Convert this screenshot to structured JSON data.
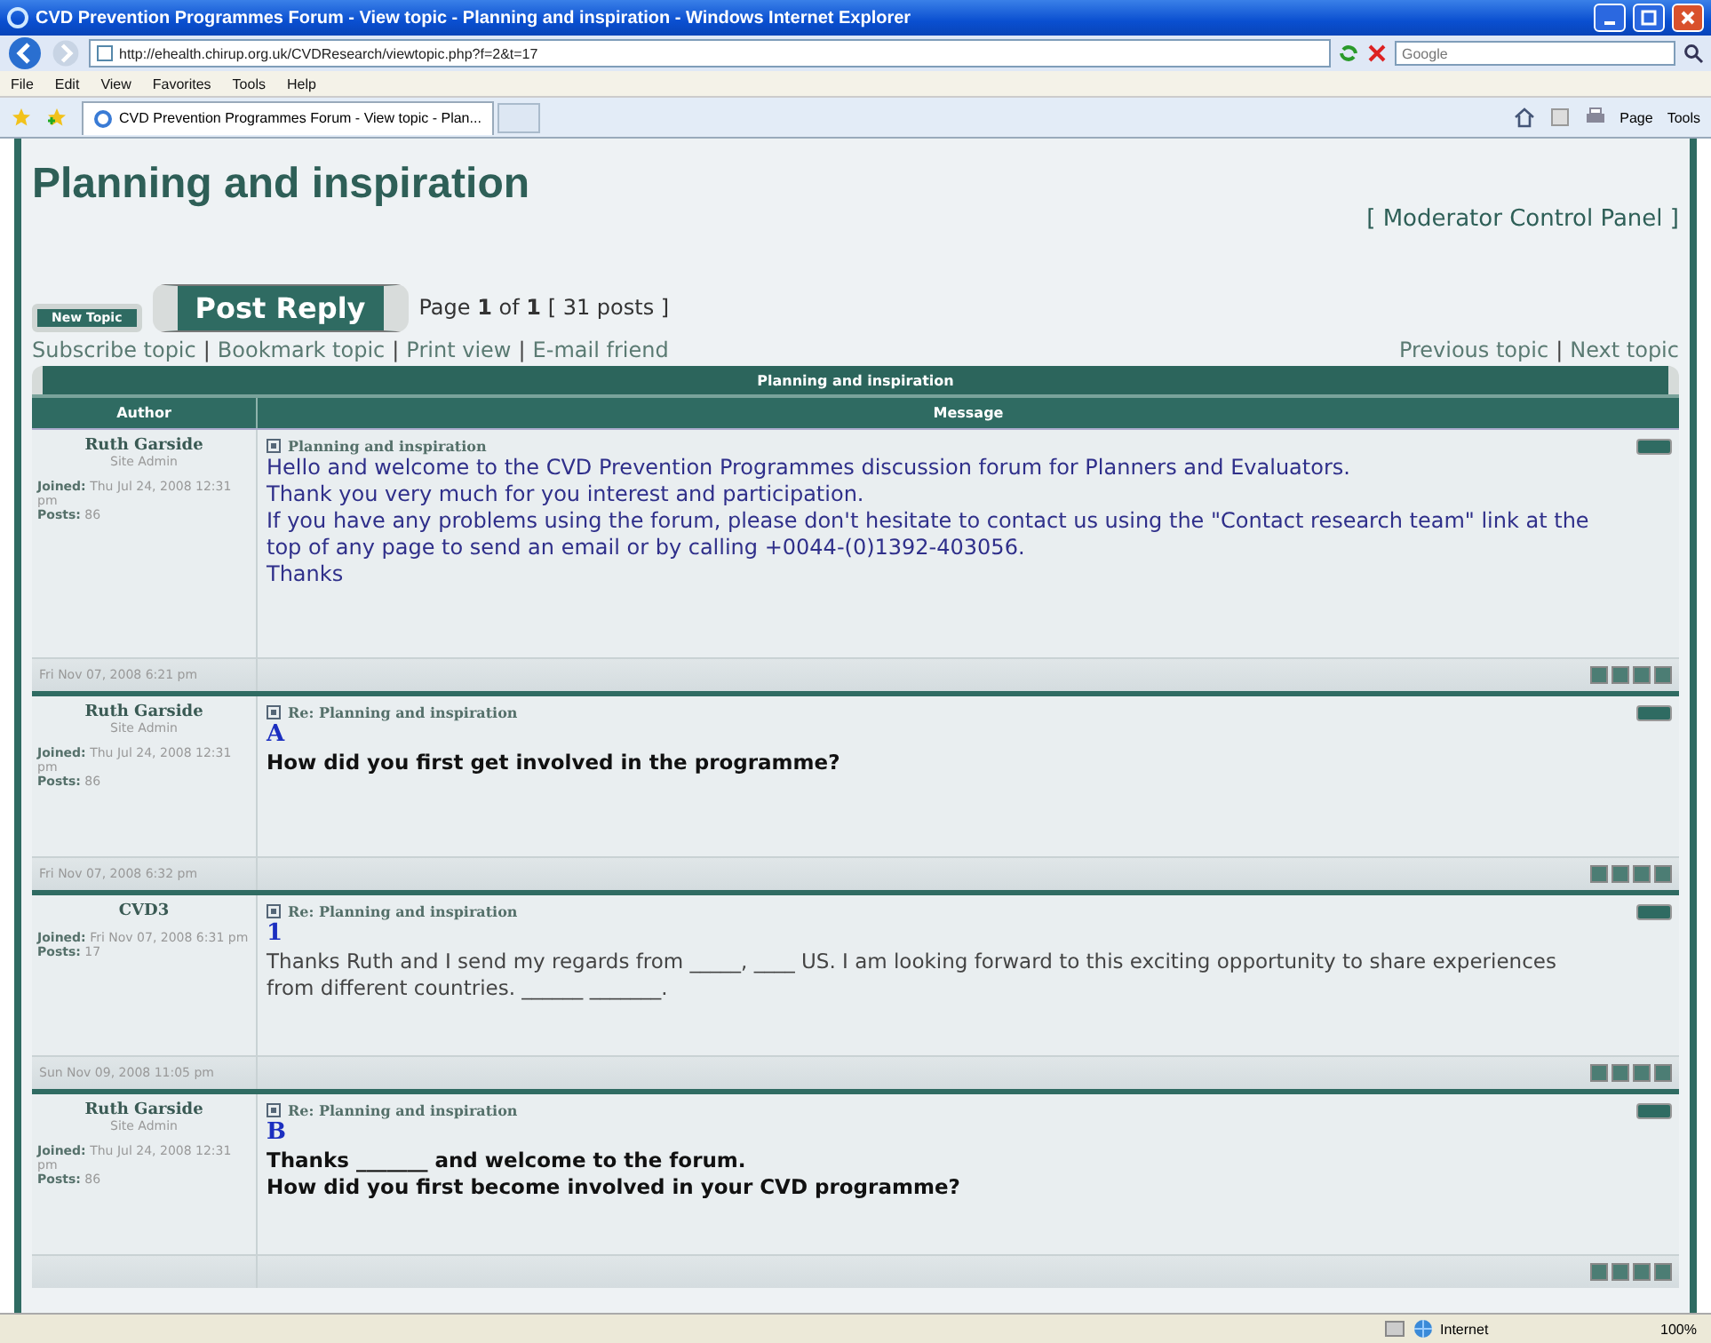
{
  "browser": {
    "title": "CVD Prevention Programmes Forum - View topic - Planning and inspiration - Windows Internet Explorer",
    "url": "http://ehealth.chirup.org.uk/CVDResearch/viewtopic.php?f=2&t=17",
    "search_placeholder": "Google",
    "menu": [
      "File",
      "Edit",
      "View",
      "Favorites",
      "Tools",
      "Help"
    ],
    "tab": "CVD Prevention Programmes Forum - View topic - Plan...",
    "toolbar": [
      "Page",
      "Tools"
    ],
    "status": {
      "zone": "Internet",
      "zoom": "100%"
    }
  },
  "topic": {
    "title": "Planning and inspiration",
    "moderator_link": "[ Moderator Control Panel ]",
    "new_topic": "New Topic",
    "post_reply": "Post Reply",
    "pagination": "Page **1** of **1**  [ 31 posts ]",
    "separator": "|",
    "actions": [
      "Subscribe topic",
      "Bookmark topic",
      "Print view",
      "E-mail friend"
    ],
    "nav": [
      "Previous topic",
      "Next topic"
    ]
  },
  "table": {
    "caption": "Planning and inspiration",
    "columns": [
      "Author",
      "Message"
    ]
  },
  "posts": [
    {
      "author": "Ruth Garside",
      "rank": "Site Admin",
      "joined_label": "Joined:",
      "joined": "Thu Jul 24, 2008 12:31 pm",
      "posts_label": "Posts:",
      "posts": "86",
      "subject": "Planning and inspiration",
      "date": "Fri Nov 07, 2008 6:21 pm",
      "lines": [
        {
          "kind": "text",
          "text": "Hello and welcome to the CVD Prevention Programmes discussion forum for Planners and Evaluators."
        },
        {
          "kind": "text",
          "text": "Thank you very much for you interest and participation."
        },
        {
          "kind": "text",
          "text": "If you have any problems using the forum, please don't hesitate to contact us using the \"Contact research team\" link at the top of any page to send an email or by calling +0044-(0)1392-403056."
        },
        {
          "kind": "text",
          "text": "Thanks"
        }
      ]
    },
    {
      "author": "Ruth Garside",
      "rank": "Site Admin",
      "joined_label": "Joined:",
      "joined": "Thu Jul 24, 2008 12:31 pm",
      "posts_label": "Posts:",
      "posts": "86",
      "subject": "Re: Planning and inspiration",
      "date": "Fri Nov 07, 2008 6:32 pm",
      "lines": [
        {
          "kind": "letter",
          "text": "A"
        },
        {
          "kind": "bold",
          "text": "How did you first get involved in the programme?"
        }
      ]
    },
    {
      "author": "CVD3",
      "joined_label": "Joined:",
      "joined": "Fri Nov 07, 2008 6:31 pm",
      "posts_label": "Posts:",
      "posts": "17",
      "subject": "Re: Planning and inspiration",
      "date": "Sun Nov 09, 2008 11:05 pm",
      "lines": [
        {
          "kind": "letter",
          "text": "1"
        },
        {
          "kind": "plain",
          "text": "Thanks Ruth and I send my regards from _____, ____ US. I am looking forward to this exciting opportunity to share experiences from different countries. ______ _______."
        }
      ]
    },
    {
      "author": "Ruth Garside",
      "rank": "Site Admin",
      "joined_label": "Joined:",
      "joined": "Thu Jul 24, 2008 12:31 pm",
      "posts_label": "Posts:",
      "posts": "86",
      "subject": "Re: Planning and inspiration",
      "lines": [
        {
          "kind": "letter",
          "text": "B"
        },
        {
          "kind": "bold",
          "text": "Thanks _______ and welcome to the forum."
        },
        {
          "kind": "bold",
          "text": "How did you first become involved in your CVD programme?"
        }
      ]
    }
  ]
}
